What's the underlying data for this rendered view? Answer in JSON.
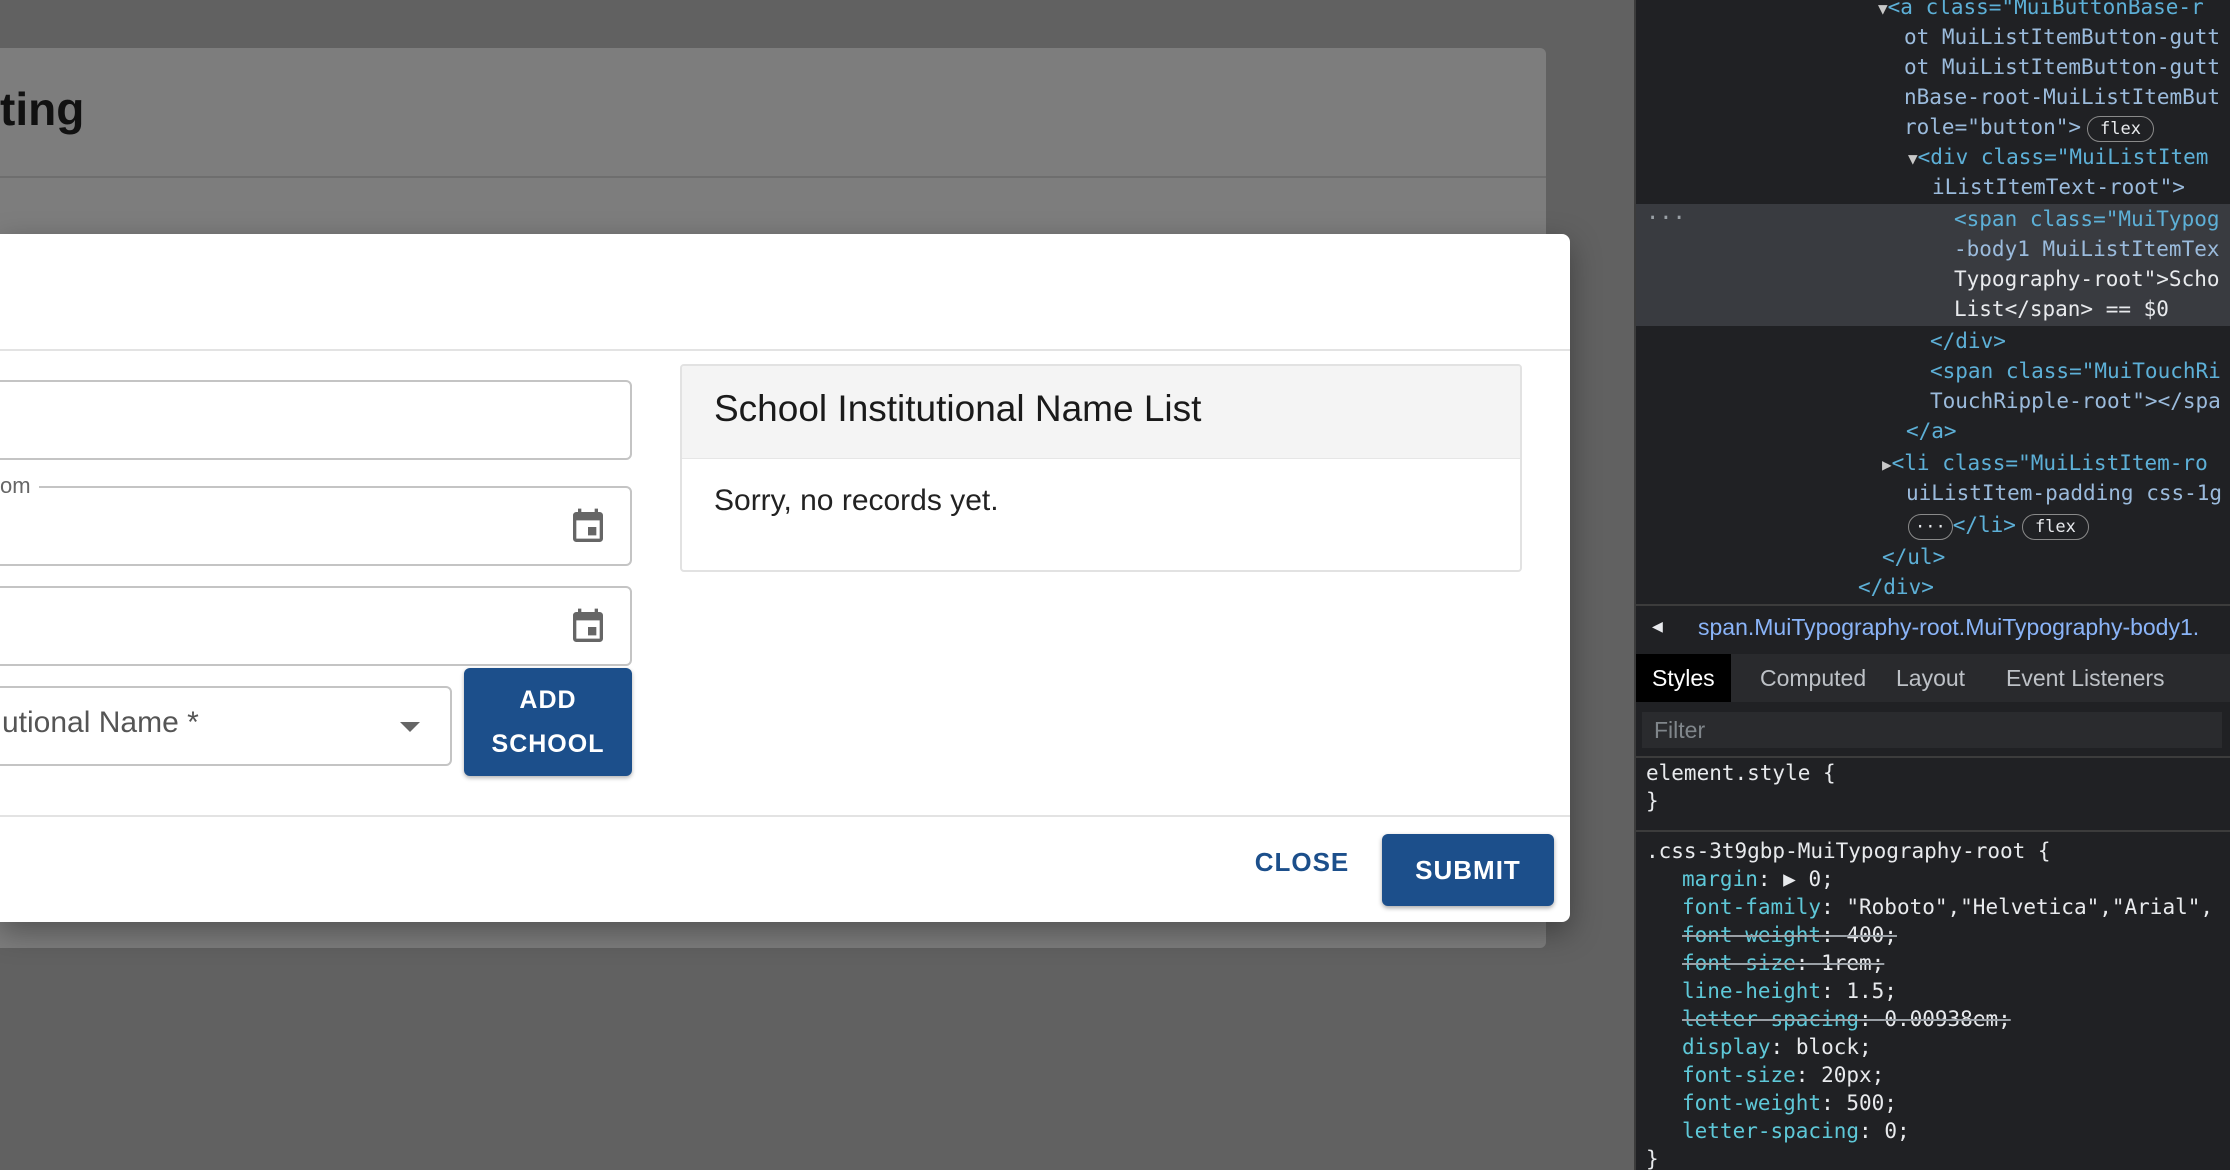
{
  "background_page": {
    "title_fragment": "ting"
  },
  "dialog": {
    "fields": {
      "date_from_label_fragment": "om",
      "date_to_label_fragment": "",
      "select_value_fragment": "utional Name *"
    },
    "add_school_label_line1": "ADD",
    "add_school_label_line2": "SCHOOL",
    "list_panel": {
      "title": "School Institutional Name List",
      "empty_message": "Sorry, no records yet."
    },
    "footer": {
      "close_label": "CLOSE",
      "submit_label": "SUBMIT"
    }
  },
  "devtools": {
    "dom_lines": [
      "<a class=\"MuiButtonBase-r",
      "ot MuiListItemButton-gutt",
      "ot MuiListItemButton-gutt",
      "nBase-root-MuiListItemBut",
      "role=\"button\">",
      "<div class=\"MuiListItem",
      "iListItemText-root\">",
      "<span class=\"MuiTypog",
      "-body1 MuiListItemTex",
      "Typography-root\">Scho",
      "List</span> == $0",
      "</div>",
      "<span class=\"MuiTouchRi",
      "TouchRipple-root\"></spa",
      "</a>",
      "<li class=\"MuiListItem-ro",
      "uiListItem-padding css-1g",
      "</li>",
      "</ul>",
      "</div>"
    ],
    "pill_flex": "flex",
    "breadcrumb": "span.MuiTypography-root.MuiTypography-body1.",
    "tabs": [
      "Styles",
      "Computed",
      "Layout",
      "Event Listeners"
    ],
    "filter_placeholder": "Filter",
    "styles": {
      "element_style": "element.style {",
      "close_brace": "}",
      "rule_selector": ".css-3t9gbp-MuiTypography-root {",
      "declarations": [
        {
          "prop": "margin",
          "value": "▶ 0;",
          "struck": false
        },
        {
          "prop": "font-family",
          "value": "\"Roboto\",\"Helvetica\",\"Arial\",",
          "struck": false
        },
        {
          "prop": "font-weight",
          "value": "400;",
          "struck": true
        },
        {
          "prop": "font-size",
          "value": "1rem;",
          "struck": true
        },
        {
          "prop": "line-height",
          "value": "1.5;",
          "struck": false
        },
        {
          "prop": "letter-spacing",
          "value": "0.00938em;",
          "struck": true
        },
        {
          "prop": "display",
          "value": "block;",
          "struck": false
        },
        {
          "prop": "font-size",
          "value": "20px;",
          "struck": false
        },
        {
          "prop": "font-weight",
          "value": "500;",
          "struck": false
        },
        {
          "prop": "letter-spacing",
          "value": "0;",
          "struck": false
        }
      ]
    }
  }
}
